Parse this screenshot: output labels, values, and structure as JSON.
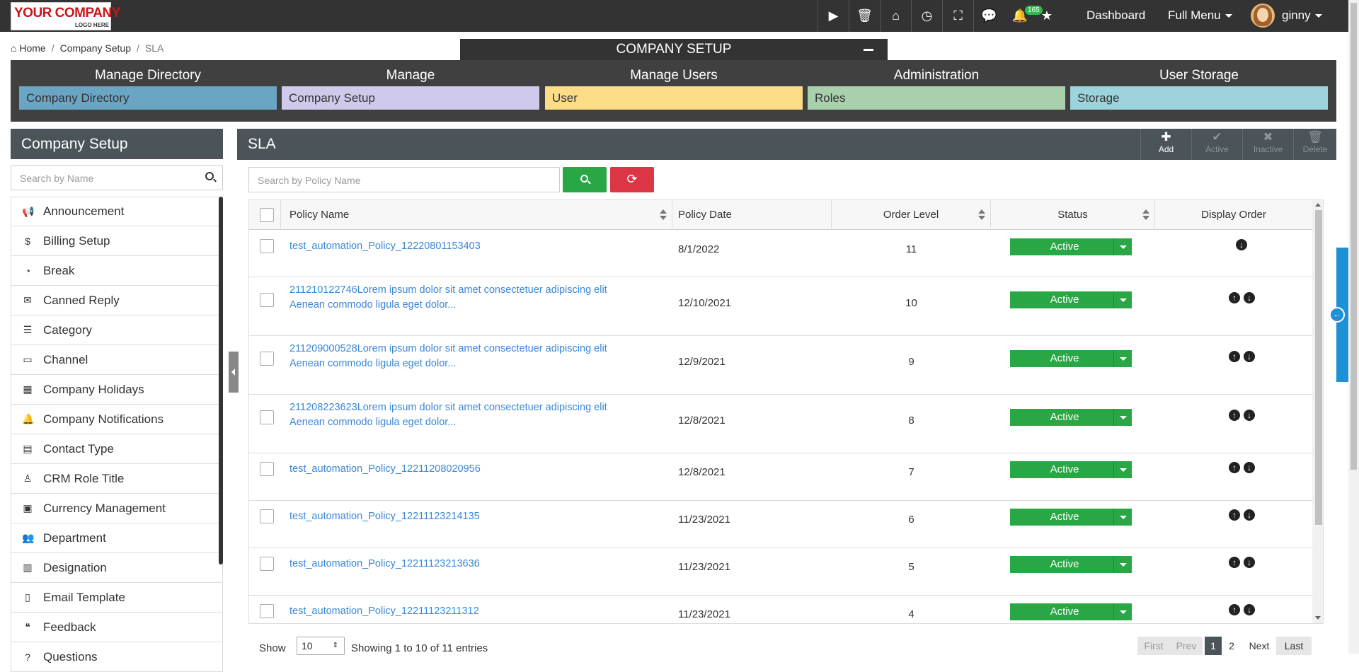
{
  "header": {
    "logo_line1": "YOUR COMPANY",
    "logo_line2": "LOGO HERE",
    "notifications_count": "165",
    "dashboard_label": "Dashboard",
    "full_menu_label": "Full Menu",
    "user_name": "ginny"
  },
  "breadcrumb": {
    "home": "Home",
    "level1": "Company Setup",
    "current": "SLA"
  },
  "company_setup_tab": "COMPANY SETUP",
  "menu": [
    {
      "header": "Manage Directory",
      "item": "Company Directory",
      "color": "#6aa6c4"
    },
    {
      "header": "Manage",
      "item": "Company Setup",
      "color": "#cfcaec"
    },
    {
      "header": "Manage Users",
      "item": "User",
      "color": "#fddc87"
    },
    {
      "header": "Administration",
      "item": "Roles",
      "color": "#a8d0ad"
    },
    {
      "header": "User Storage",
      "item": "Storage",
      "color": "#9cd3dd"
    }
  ],
  "left_panel": {
    "title": "Company Setup",
    "search_placeholder": "Search by Name",
    "items": [
      {
        "label": "Announcement",
        "icon": "megaphone-icon"
      },
      {
        "label": "Billing Setup",
        "icon": "dollar-icon"
      },
      {
        "label": "Break",
        "icon": "clock-icon"
      },
      {
        "label": "Canned Reply",
        "icon": "envelope-icon"
      },
      {
        "label": "Category",
        "icon": "list-icon"
      },
      {
        "label": "Channel",
        "icon": "monitor-icon"
      },
      {
        "label": "Company Holidays",
        "icon": "calendar-icon"
      },
      {
        "label": "Company Notifications",
        "icon": "bell-icon"
      },
      {
        "label": "Contact Type",
        "icon": "card-icon"
      },
      {
        "label": "CRM Role Title",
        "icon": "user-icon"
      },
      {
        "label": "Currency Management",
        "icon": "money-icon"
      },
      {
        "label": "Department",
        "icon": "users-icon"
      },
      {
        "label": "Designation",
        "icon": "id-card-icon"
      },
      {
        "label": "Email Template",
        "icon": "file-icon"
      },
      {
        "label": "Feedback",
        "icon": "quote-icon"
      },
      {
        "label": "Questions",
        "icon": "question-icon"
      }
    ]
  },
  "main": {
    "title": "SLA",
    "toolbar": {
      "add": "Add",
      "active": "Active",
      "inactive": "Inactive",
      "delete": "Delete"
    },
    "search_placeholder": "Search by Policy Name",
    "columns": {
      "policy_name": "Policy Name",
      "policy_date": "Policy Date",
      "order_level": "Order Level",
      "status": "Status",
      "display_order": "Display Order"
    },
    "rows": [
      {
        "name1": "test_automation_Policy_12220801153403",
        "name2": "",
        "date": "8/1/2022",
        "order": "11",
        "status": "Active",
        "up": false,
        "down": true
      },
      {
        "name1": "211210122746Lorem ipsum dolor sit amet consectetuer adipiscing elit",
        "name2": "Aenean commodo ligula eget dolor...",
        "date": "12/10/2021",
        "order": "10",
        "status": "Active",
        "up": true,
        "down": true
      },
      {
        "name1": "211209000528Lorem ipsum dolor sit amet consectetuer adipiscing elit",
        "name2": "Aenean commodo ligula eget dolor...",
        "date": "12/9/2021",
        "order": "9",
        "status": "Active",
        "up": true,
        "down": true
      },
      {
        "name1": "211208223623Lorem ipsum dolor sit amet consectetuer adipiscing elit",
        "name2": "Aenean commodo ligula eget dolor...",
        "date": "12/8/2021",
        "order": "8",
        "status": "Active",
        "up": true,
        "down": true
      },
      {
        "name1": "test_automation_Policy_12211208020956",
        "name2": "",
        "date": "12/8/2021",
        "order": "7",
        "status": "Active",
        "up": true,
        "down": true
      },
      {
        "name1": "test_automation_Policy_12211123214135",
        "name2": "",
        "date": "11/23/2021",
        "order": "6",
        "status": "Active",
        "up": true,
        "down": true
      },
      {
        "name1": "test_automation_Policy_12211123213636",
        "name2": "",
        "date": "11/23/2021",
        "order": "5",
        "status": "Active",
        "up": true,
        "down": true
      },
      {
        "name1": "test_automation_Policy_12211123211312",
        "name2": "",
        "date": "11/23/2021",
        "order": "4",
        "status": "Active",
        "up": true,
        "down": true
      }
    ],
    "footer": {
      "show_label": "Show",
      "page_size": "10",
      "info": "Showing 1 to 10 of 11 entries",
      "first": "First",
      "prev": "Prev",
      "page1": "1",
      "page2": "2",
      "next": "Next",
      "last": "Last"
    }
  }
}
